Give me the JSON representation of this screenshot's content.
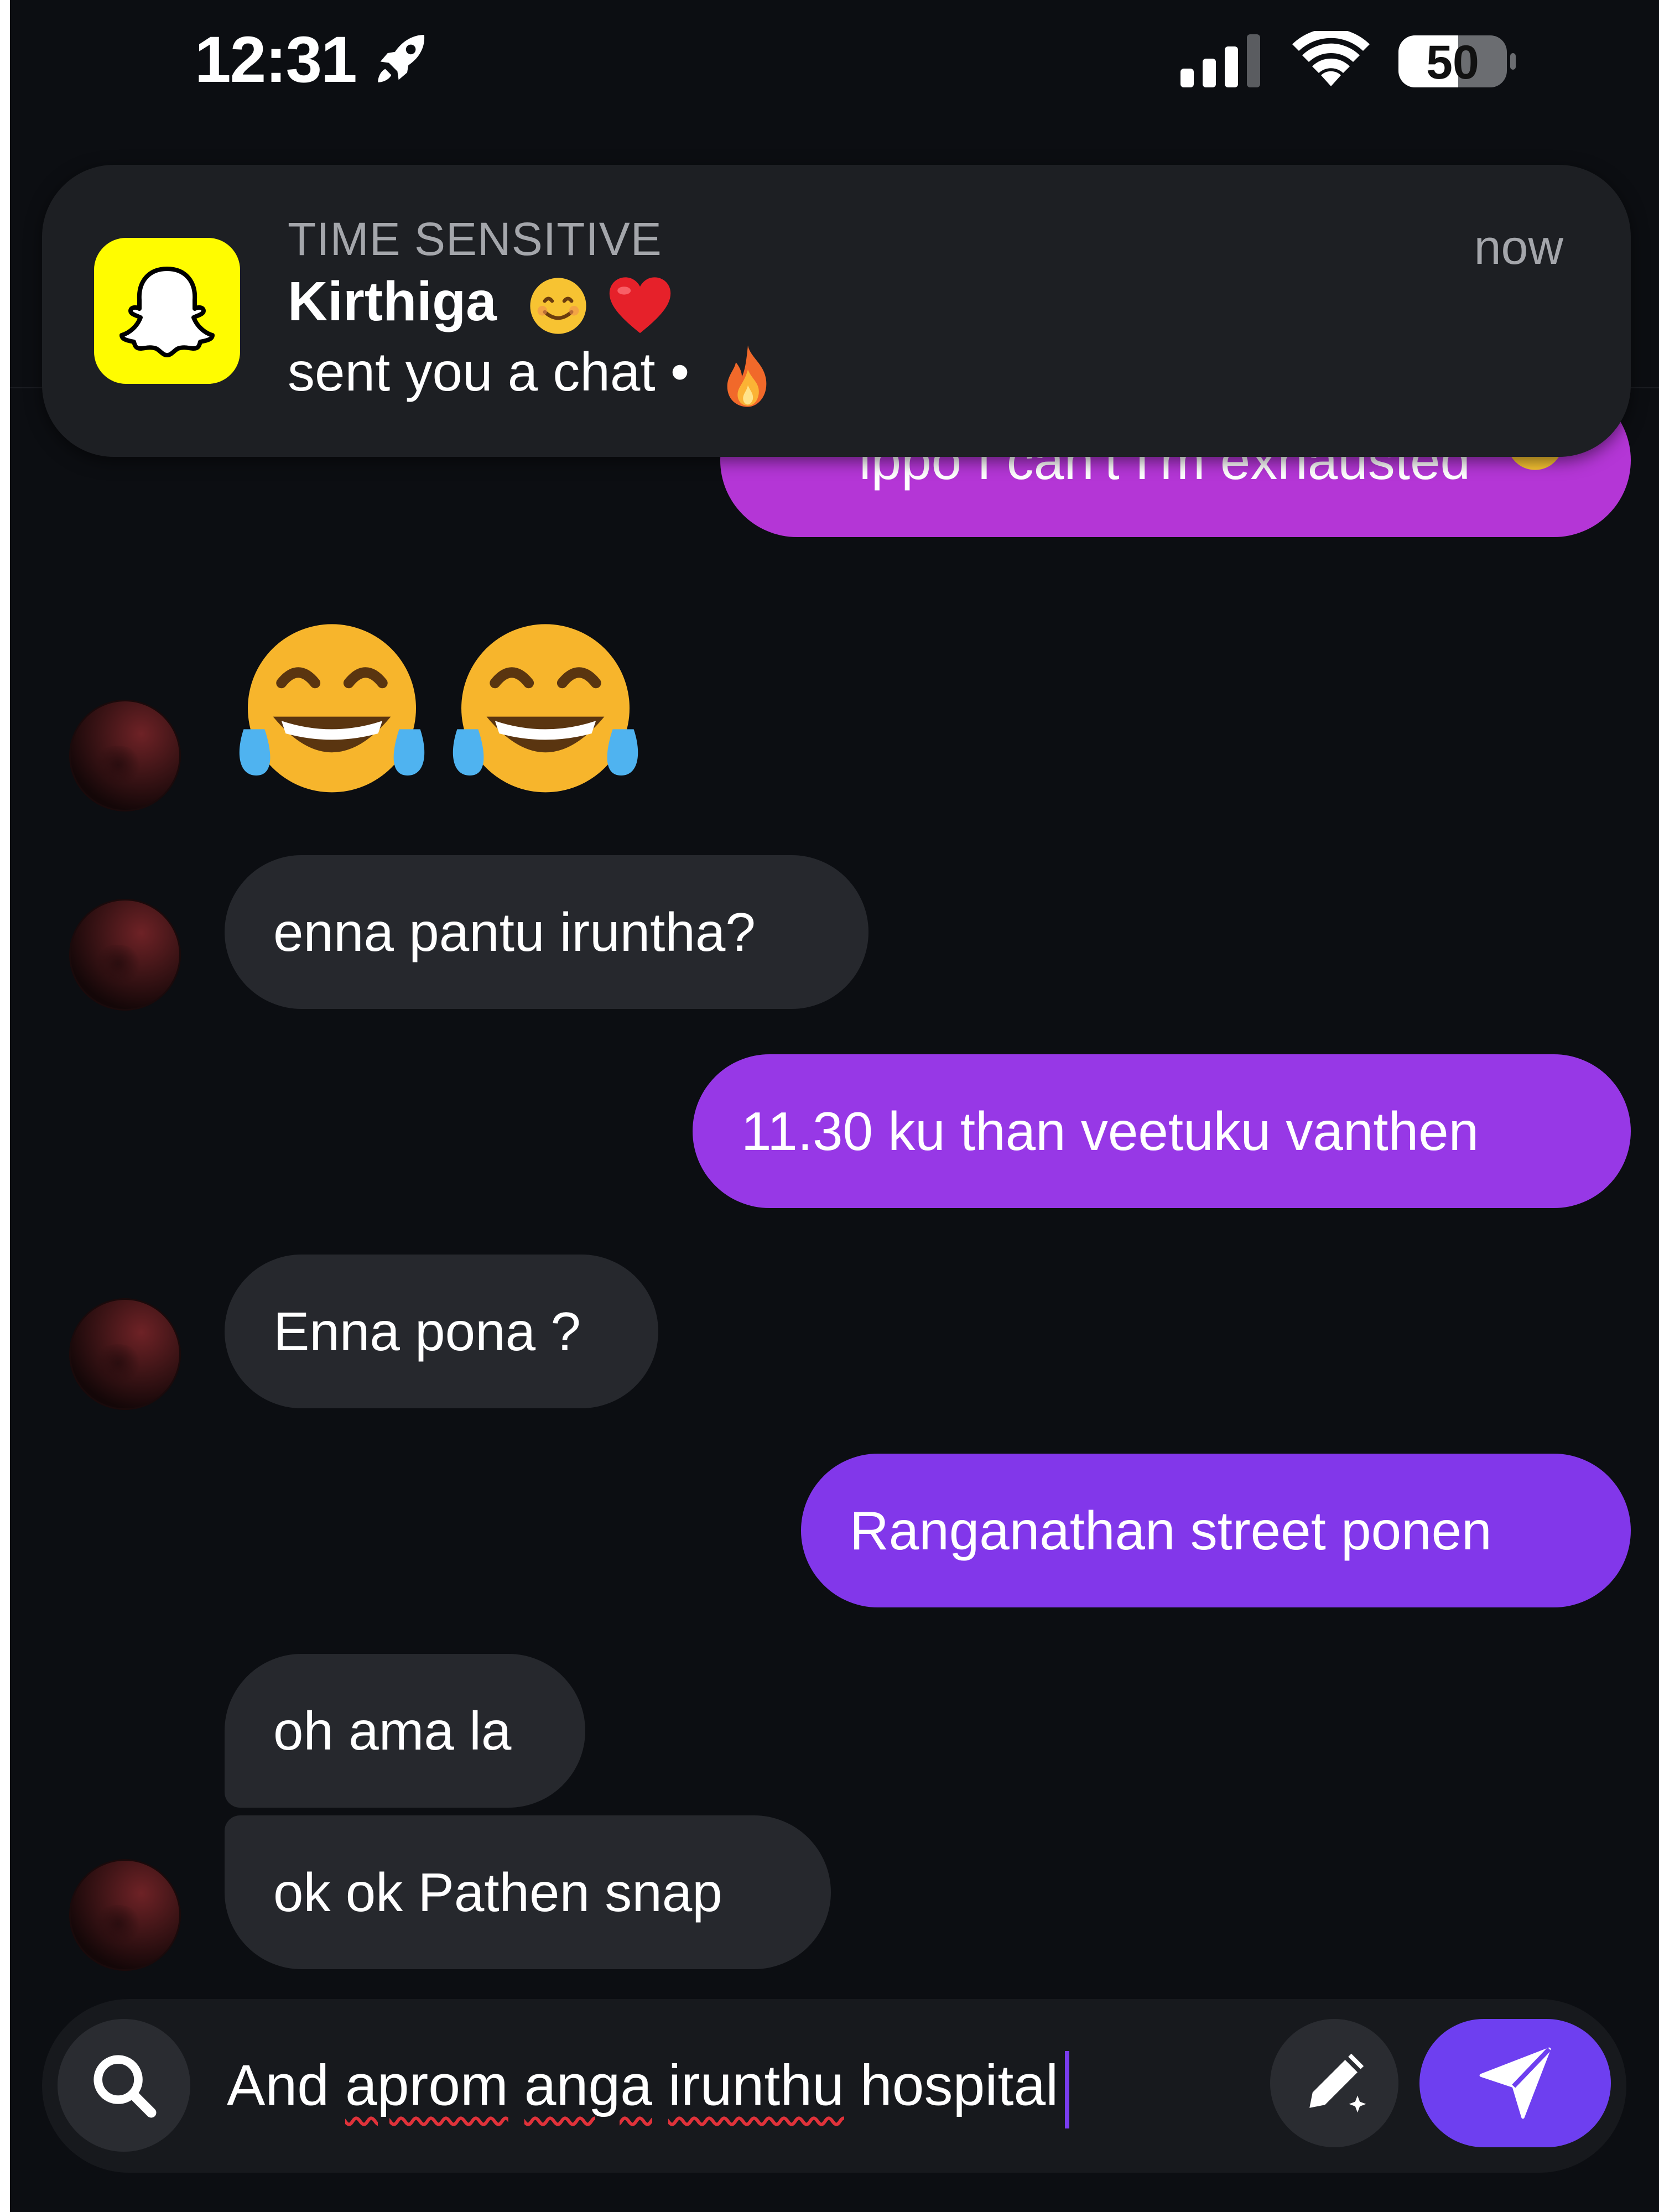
{
  "status": {
    "time": "12:31",
    "battery": "50"
  },
  "notification": {
    "label": "TIME SENSITIVE",
    "sender": "Kirthiga",
    "body": "sent you a chat •",
    "time": "now"
  },
  "messages": [
    {
      "side": "out",
      "text": "ippo I can't I'm exhausted"
    },
    {
      "side": "in",
      "text": "😂😂"
    },
    {
      "side": "in",
      "text": "enna pantu iruntha?"
    },
    {
      "side": "out",
      "text": "11.30 ku than veetuku vanthen"
    },
    {
      "side": "in",
      "text": "Enna pona ?"
    },
    {
      "side": "out",
      "text": "Ranganathan street ponen"
    },
    {
      "side": "in",
      "text": "oh ama la"
    },
    {
      "side": "in",
      "text": "ok ok Pathen snap"
    }
  ],
  "composer": {
    "text_prefix": "And ",
    "word1": "aprom",
    "space1": " ",
    "word2": "anga",
    "space2": " ",
    "word3": "irunthu",
    "text_suffix": " hospital"
  },
  "colors": {
    "background": "#0c0e12",
    "incoming_bubble": "#26282d",
    "outgoing_top": "#b436d6",
    "outgoing_mid": "#9738e6",
    "outgoing_low": "#8237ea",
    "send_button": "#6e3ff0",
    "snapchat_yellow": "#fffc00"
  }
}
